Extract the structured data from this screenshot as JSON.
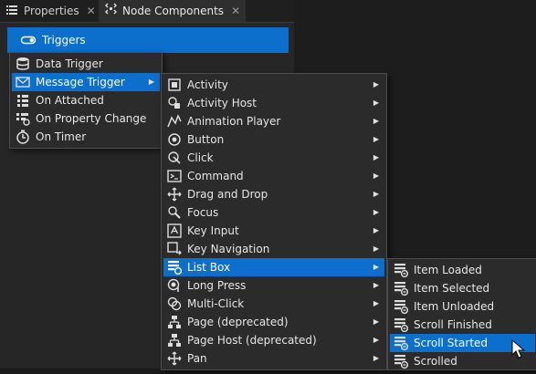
{
  "tabs": [
    {
      "label": "Properties",
      "icon": "list-icon",
      "close": "✕"
    },
    {
      "label": "Node Components",
      "icon": "components-icon",
      "close": "✕"
    }
  ],
  "triggers_bar": {
    "label": "Triggers",
    "icon": "trigger-icon"
  },
  "menu1": {
    "items": [
      {
        "label": "Data Trigger",
        "icon": "database-icon",
        "submenu": false,
        "highlighted": false
      },
      {
        "label": "Message Trigger",
        "icon": "message-icon",
        "submenu": true,
        "highlighted": true
      },
      {
        "label": "On Attached",
        "icon": "attached-icon",
        "submenu": false,
        "highlighted": false
      },
      {
        "label": "On Property Change",
        "icon": "property-change-icon",
        "submenu": false,
        "highlighted": false
      },
      {
        "label": "On Timer",
        "icon": "timer-icon",
        "submenu": false,
        "highlighted": false
      }
    ]
  },
  "menu2": {
    "items": [
      {
        "label": "Activity",
        "icon": "activity-icon",
        "highlighted": false
      },
      {
        "label": "Activity Host",
        "icon": "activity-host-icon",
        "highlighted": false
      },
      {
        "label": "Animation Player",
        "icon": "animation-icon",
        "highlighted": false
      },
      {
        "label": "Button",
        "icon": "button-icon",
        "highlighted": false
      },
      {
        "label": "Click",
        "icon": "click-icon",
        "highlighted": false
      },
      {
        "label": "Command",
        "icon": "command-icon",
        "highlighted": false
      },
      {
        "label": "Drag and Drop",
        "icon": "drag-drop-icon",
        "highlighted": false
      },
      {
        "label": "Focus",
        "icon": "focus-icon",
        "highlighted": false
      },
      {
        "label": "Key Input",
        "icon": "key-input-icon",
        "highlighted": false
      },
      {
        "label": "Key Navigation",
        "icon": "key-navigation-icon",
        "highlighted": false
      },
      {
        "label": "List Box",
        "icon": "list-box-icon",
        "highlighted": true
      },
      {
        "label": "Long Press",
        "icon": "long-press-icon",
        "highlighted": false
      },
      {
        "label": "Multi-Click",
        "icon": "multi-click-icon",
        "highlighted": false
      },
      {
        "label": "Page (deprecated)",
        "icon": "page-icon",
        "highlighted": false
      },
      {
        "label": "Page Host (deprecated)",
        "icon": "page-host-icon",
        "highlighted": false
      },
      {
        "label": "Pan",
        "icon": "pan-icon",
        "highlighted": false
      }
    ]
  },
  "menu3": {
    "items": [
      {
        "label": "Item Loaded",
        "icon": "list-event-icon",
        "highlighted": false
      },
      {
        "label": "Item Selected",
        "icon": "list-event-icon",
        "highlighted": false
      },
      {
        "label": "Item Unloaded",
        "icon": "list-event-icon",
        "highlighted": false
      },
      {
        "label": "Scroll Finished",
        "icon": "list-event-icon",
        "highlighted": false
      },
      {
        "label": "Scroll Started",
        "icon": "list-event-icon",
        "highlighted": true
      },
      {
        "label": "Scrolled",
        "icon": "list-event-icon",
        "highlighted": false
      }
    ]
  },
  "colors": {
    "accent": "#0c6fcb",
    "menu_bg": "#2b2b2b",
    "panel_bg": "#262626"
  }
}
